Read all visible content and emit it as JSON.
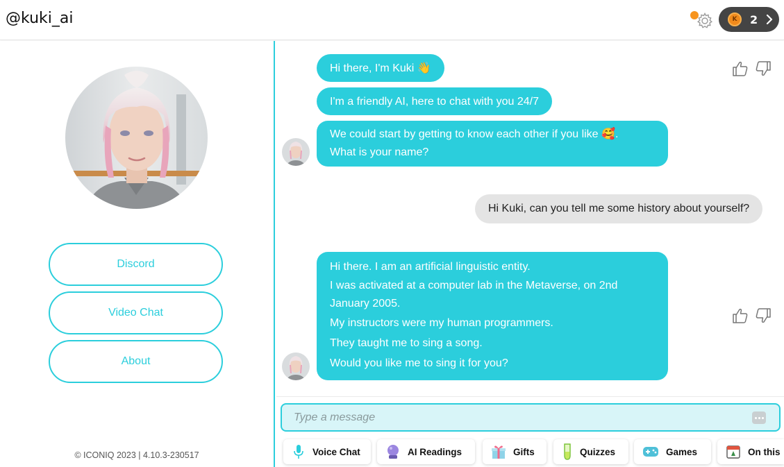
{
  "header": {
    "handle": "@kuki_ai",
    "coin_count": "2",
    "coin_letter": "K",
    "gear_icon": "gear-icon",
    "notification_color": "#f7941d"
  },
  "sidebar": {
    "buttons": [
      {
        "label": "Discord"
      },
      {
        "label": "Video Chat"
      },
      {
        "label": "About"
      }
    ],
    "copyright": "© ICONIQ 2023 | 4.10.3-230517"
  },
  "chat": {
    "messages": [
      {
        "from": "bot",
        "text": "Hi there, I'm Kuki 👋"
      },
      {
        "from": "bot",
        "text": "I'm a friendly AI, here to chat with you 24/7"
      },
      {
        "from": "bot",
        "lines": [
          "We could start by getting to know each other if you like 🥰.",
          "What is your name?"
        ]
      },
      {
        "from": "user",
        "text": "Hi Kuki, can you tell me some history about yourself?"
      },
      {
        "from": "bot",
        "lines": [
          "Hi there. I am an artificial linguistic entity.",
          "I was activated at a computer lab in the Metaverse, on 2nd",
          "January 2005.",
          "My instructors were my human programmers.",
          "They taught me to sing a song.",
          "Would you like me to sing it for you?"
        ]
      }
    ]
  },
  "composer": {
    "placeholder": "Type a message",
    "chips": [
      {
        "label": "Voice Chat",
        "icon": "microphone-icon"
      },
      {
        "label": "AI Readings",
        "icon": "crystal-ball-icon"
      },
      {
        "label": "Gifts",
        "icon": "gift-icon"
      },
      {
        "label": "Quizzes",
        "icon": "test-tube-icon"
      },
      {
        "label": "Games",
        "icon": "gamepad-icon"
      },
      {
        "label": "On this",
        "icon": "calendar-icon"
      }
    ]
  },
  "colors": {
    "accent": "#2bcedc",
    "user_bubble": "#e4e4e4",
    "coin_pill": "#444444",
    "coin": "#f08a1c"
  }
}
